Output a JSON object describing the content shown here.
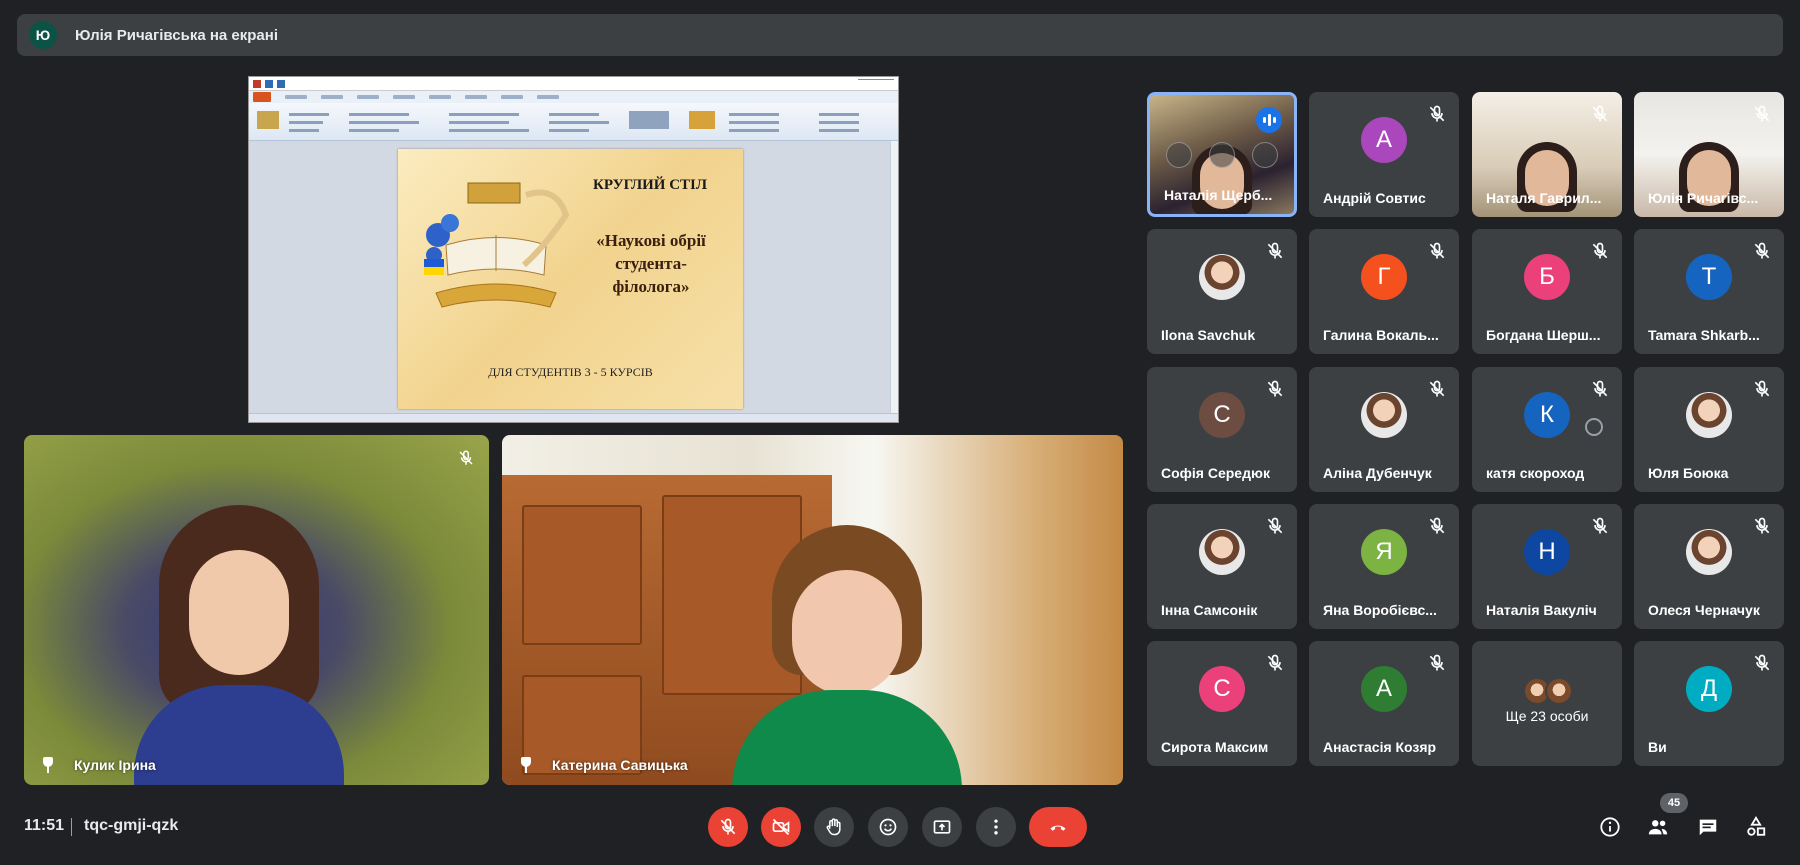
{
  "banner": {
    "avatar_letter": "Ю",
    "text": "Юлія Ричагівська на екрані"
  },
  "presentation": {
    "slide_title": "КРУГЛИЙ СТІЛ",
    "slide_subtitle": "«Наукові обрії студента-філолога»",
    "slide_footer": "ДЛЯ СТУДЕНТІВ 3 - 5 КУРСІВ"
  },
  "videos": [
    {
      "name": "Кулик Ірина",
      "pinned": true,
      "muted": true
    },
    {
      "name": "Катерина Савицька",
      "pinned": true,
      "muted": false
    }
  ],
  "participants": [
    {
      "name": "Наталія Щерб...",
      "type": "camera",
      "speaking": true
    },
    {
      "name": "Андрій Совтис",
      "letter": "А",
      "color": "#ab47bc",
      "muted": true
    },
    {
      "name": "Наталя Гаврил...",
      "type": "camera",
      "muted": true
    },
    {
      "name": "Юлія Ричагівс...",
      "type": "camera",
      "muted": true
    },
    {
      "name": "Ilona Savchuk",
      "type": "photo",
      "muted": true
    },
    {
      "name": "Галина Вокаль...",
      "letter": "Г",
      "color": "#f4511e",
      "muted": true
    },
    {
      "name": "Богдана Шерш...",
      "letter": "Б",
      "color": "#ec407a",
      "muted": true
    },
    {
      "name": "Tamara Shkarb...",
      "letter": "T",
      "color": "#1565c0",
      "muted": true
    },
    {
      "name": "Софія Середюк",
      "letter": "С",
      "color": "#6d4c41",
      "muted": true
    },
    {
      "name": "Аліна Дубенчук",
      "type": "photo",
      "muted": true
    },
    {
      "name": "катя скороход",
      "letter": "К",
      "color": "#1565c0",
      "muted": true,
      "hover": true
    },
    {
      "name": "Юля Боюка",
      "type": "photo",
      "muted": true
    },
    {
      "name": "Інна Самсонік",
      "type": "photo",
      "muted": true
    },
    {
      "name": "Яна Воробієвс...",
      "letter": "Я",
      "color": "#7cb342",
      "muted": true
    },
    {
      "name": "Наталія Вакуліч",
      "letter": "Н",
      "color": "#0d47a1",
      "muted": true
    },
    {
      "name": "Олеся Черначук",
      "type": "photo",
      "muted": true
    },
    {
      "name": "Сирота Максим",
      "letter": "С",
      "color": "#ec407a",
      "muted": true
    },
    {
      "name": "Анастасія Козяр",
      "letter": "А",
      "color": "#2e7d32",
      "muted": true
    },
    {
      "name": "Ще 23 особи",
      "type": "more"
    },
    {
      "name": "Ви",
      "letter": "Д",
      "color": "#00acc1",
      "muted": true
    }
  ],
  "bottom": {
    "time": "11:51",
    "meeting_code": "tqc-gmji-qzk",
    "people_count": "45"
  },
  "colors": {
    "background": "#202124",
    "tile": "#3c4043",
    "danger": "#ea4335",
    "accent": "#8ab4f8"
  }
}
